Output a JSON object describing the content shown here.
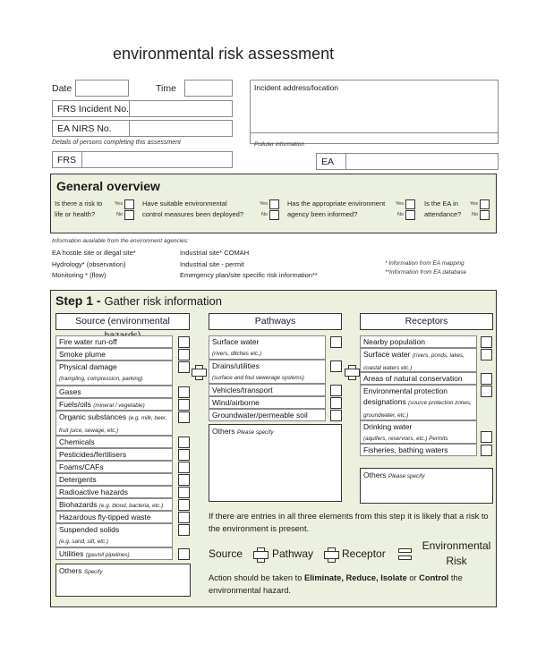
{
  "title": "environmental risk assessment",
  "header": {
    "date_label": "Date",
    "time_label": "Time",
    "frs_incident_label": "FRS Incident No.",
    "ea_nirs_label": "EA NIRS No.",
    "details_note": "Details of persons completing this assessment",
    "frs_label": "FRS",
    "ea_label": "EA",
    "incident_address_label": "Incident address/location",
    "polluter_label": "Polluter information",
    "date_value": "",
    "time_value": "",
    "frs_incident_value": "",
    "ea_nirs_value": "",
    "frs_value": "",
    "ea_value": "",
    "incident_address_value": "",
    "polluter_value": ""
  },
  "general_overview": {
    "heading": "General overview",
    "yes_label": "Yes",
    "no_label": "No",
    "questions": [
      {
        "line1": "Is there a risk to",
        "line2": "life or health?",
        "yes": false,
        "no": false
      },
      {
        "line1": "Have suitable environmental",
        "line2": "control measures been deployed?",
        "yes": false,
        "no": false
      },
      {
        "line1": "Has the appropriate environment",
        "line2": "agency been informed?",
        "yes": false,
        "no": false
      },
      {
        "line1": "Is the EA in",
        "line2": "attendance?",
        "yes": false,
        "no": false
      }
    ]
  },
  "agency_info": {
    "heading": "Information available from the environment agencies:",
    "col1": [
      "EA hostile site or illegal site*",
      "Hydrology* (observation)",
      "Monitoring * (flow)"
    ],
    "col2": [
      "Industrial site* COMAH",
      "Industrial site - permit",
      "Emergency plan/site specific risk information**"
    ],
    "footnotes": [
      "* Information from EA mapping",
      "**Information from EA database"
    ]
  },
  "step1": {
    "heading_bold": "Step 1 -",
    "heading_rest": "Gather risk information",
    "source": {
      "header": "Source (environmental hazards)",
      "items": [
        {
          "label": "Fire water run-off",
          "sub": ""
        },
        {
          "label": "Smoke plume",
          "sub": ""
        },
        {
          "label": "Physical damage",
          "sub": "(trampling, compression, parking)"
        },
        {
          "label": "Gases",
          "sub": ""
        },
        {
          "label": "Fuels/oils",
          "sub": "(mineral / vegetable)"
        },
        {
          "label": "Organic substances",
          "sub": "(e.g. milk, beer, fruit juice, sewage, etc.)"
        },
        {
          "label": "Chemicals",
          "sub": ""
        },
        {
          "label": "Pesticides/fertilisers",
          "sub": ""
        },
        {
          "label": "Foams/CAFs",
          "sub": ""
        },
        {
          "label": "Detergents",
          "sub": ""
        },
        {
          "label": "Radioactive hazards",
          "sub": ""
        },
        {
          "label": "Biohazards",
          "sub": "(e.g. blood, bacteria, etc.)"
        },
        {
          "label": "Hazardous fly-tipped waste",
          "sub": ""
        },
        {
          "label": "Suspended solids",
          "sub": "(e.g. sand, silt, etc.)"
        },
        {
          "label": "Utilities",
          "sub": "(gas/oil pipelines)"
        }
      ],
      "others_label": "Others",
      "others_hint": "Specify"
    },
    "pathways": {
      "header": "Pathways",
      "items": [
        {
          "label": "Surface water",
          "sub": "(rivers, ditches etc.)"
        },
        {
          "label": "Drains/utilities",
          "sub": "(surface and foul sewerage systems)"
        },
        {
          "label": "Vehicles/transport",
          "sub": ""
        },
        {
          "label": "Wind/airborne",
          "sub": ""
        },
        {
          "label": "Groundwater/permeable soil",
          "sub": ""
        }
      ],
      "others_label": "Others",
      "others_hint": "Please specify"
    },
    "receptors": {
      "header": "Receptors",
      "items": [
        {
          "label": "Nearby population",
          "sub": ""
        },
        {
          "label": "Surface water",
          "sub": "(rivers, ponds, lakes, coastal waters etc.)"
        },
        {
          "label": "Areas of natural conservation",
          "sub": ""
        },
        {
          "label": "Environmental protection designations",
          "sub": "(source protection zones, groundwater, etc.)"
        },
        {
          "label": "Drinking water",
          "sub": "(aquifers, reservoirs, etc.) Permits"
        },
        {
          "label": "Fisheries, bathing waters",
          "sub": ""
        }
      ],
      "others_label": "Others",
      "others_hint": "Please specify"
    },
    "explanation": "If there are entries in all three elements from this step it is likely that a risk to the environment is present.",
    "equation": {
      "source": "Source",
      "pathway": "Pathway",
      "receptor": "Receptor",
      "result_line1": "Environmental",
      "result_line2": "Risk"
    },
    "action": {
      "prefix": "Action should be taken to ",
      "eliminate": "Eliminate,",
      "reduce": "Reduce,",
      "isolate": "Isolate",
      "or": " or ",
      "control": "Control",
      "suffix": " the environmental hazard."
    }
  }
}
